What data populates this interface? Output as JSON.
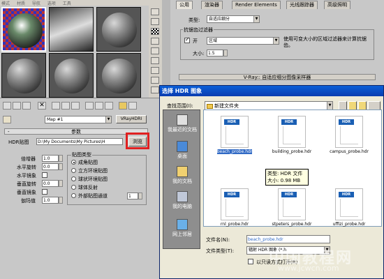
{
  "menubar": {
    "items": [
      "模式",
      "材质",
      "导航",
      "选项",
      "工具"
    ]
  },
  "material_row": {
    "map_name": "Map #1",
    "map_type": "VRayHDRI"
  },
  "params": {
    "rollout_title": "参数",
    "hdr_map_label": "HDR贴图",
    "hdr_path": "D:\\My Documents\\My Pictures\\H",
    "browse_label": "浏览",
    "multiplier_label": "倍增器",
    "multiplier_value": "1.0",
    "h_rotation_label": "水平旋转",
    "h_rotation_value": "0.0",
    "h_flip_label": "水平镜象",
    "v_rotation_label": "垂直旋转",
    "v_rotation_value": "0.0",
    "v_flip_label": "垂直镜象",
    "gamma_label": "伽玛值",
    "gamma_value": "1.0",
    "map_type_group": "贴图类型",
    "map_types": [
      "成角贴图",
      "立方环境贴图",
      "球状环境贴图",
      "球体反射",
      "外部贴图通道"
    ],
    "channel_value": "1"
  },
  "render_setup": {
    "tabs": [
      "公用",
      "渲染器",
      "Render Elements",
      "光线跟踪器",
      "高级照明"
    ],
    "type_label": "类型:",
    "type_value": "自适应细分",
    "aa_filter_title": "抗锯齿过滤器",
    "on_label": "开",
    "filter_value": "区域",
    "filter_desc": "使用可变大小的区域过滤器来计算抗锯齿。",
    "size_label": "大小:",
    "size_value": "1.5",
    "rollout_footer": "V-Ray:: 自适应细分图像采样器"
  },
  "dialog": {
    "title": "选择 HDR 图象",
    "look_in_label": "查找范围(I):",
    "look_in_value": "新建文件夹",
    "places": [
      "我最近的文档",
      "桌面",
      "我的文档",
      "我的电脑",
      "网上邻居"
    ],
    "files": [
      {
        "name": "beach_probe.hdr",
        "tag": "HDR"
      },
      {
        "name": "building_probe.hdr",
        "tag": "HDR"
      },
      {
        "name": "campus_probe.hdr",
        "tag": "HDR"
      },
      {
        "name": "rnl_probe.hdr",
        "tag": "HDR"
      },
      {
        "name": "stpeters_probe.hdr",
        "tag": "HDR"
      },
      {
        "name": "uffizi_probe.hdr",
        "tag": "HDR"
      }
    ],
    "tooltip_line1": "类型: HDR 文件",
    "tooltip_line2": "大小: 0.98 MB",
    "filename_label": "文件名(N):",
    "filename_value": "beach_probe.hdr",
    "filetype_label": "文件类型(T):",
    "filetype_value": "辐射 HDR 图象 (*.h",
    "readonly_label": "以只读方式打开(R)"
  },
  "watermark": {
    "line1": "中国教程网",
    "line2": "www.jcwcn.com"
  },
  "colors": {
    "accent": "#e02020",
    "title_bar": "#0a5fd8",
    "selection": "#316ac5"
  }
}
